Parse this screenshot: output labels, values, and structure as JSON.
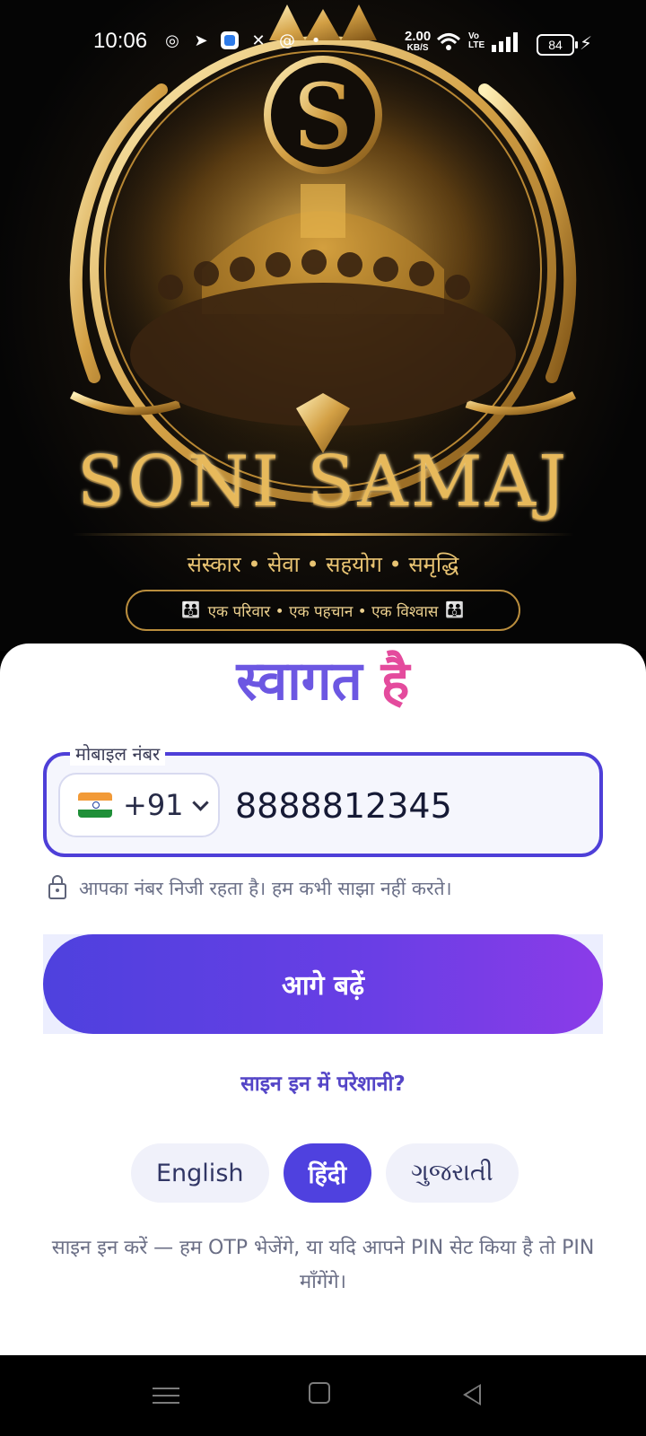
{
  "status_bar": {
    "time": "10:06",
    "network_speed": "2.00",
    "speed_unit": "KB/S",
    "volte": "Vo LTE",
    "battery": "84",
    "icons": [
      "whatsapp-icon",
      "telegram-icon",
      "blue-app-icon",
      "x-icon",
      "threads-icon",
      "dot-icon",
      "wifi-icon",
      "signal-icon",
      "charging-icon"
    ]
  },
  "hero": {
    "emblem_letter": "S",
    "brand": "SONI SAMAJ",
    "tagline": "संस्कार • सेवा • सहयोग • समृद्धि",
    "pill_text": "एक परिवार • एक पहचान • एक विश्वास"
  },
  "welcome": {
    "part1": "स्वागत",
    "part2": "है"
  },
  "phone": {
    "label": "मोबाइल नंबर",
    "country_code": "+91",
    "value": "8888812345",
    "privacy_note": "आपका नंबर निजी रहता है। हम कभी साझा नहीं करते।"
  },
  "cta_label": "आगे बढ़ें",
  "trouble_link": "साइन इन में परेशानी?",
  "languages": [
    "English",
    "हिंदी",
    "ગુજરાતી"
  ],
  "selected_language": "हिंदी",
  "signin_note": "साइन इन करें — हम OTP भेजेंगे, या यदि आपने PIN सेट किया है तो PIN माँगेंगे।",
  "colors": {
    "primary": "#4f41df",
    "accent_pink": "#e44b9d",
    "gold": "#e7b95b"
  }
}
